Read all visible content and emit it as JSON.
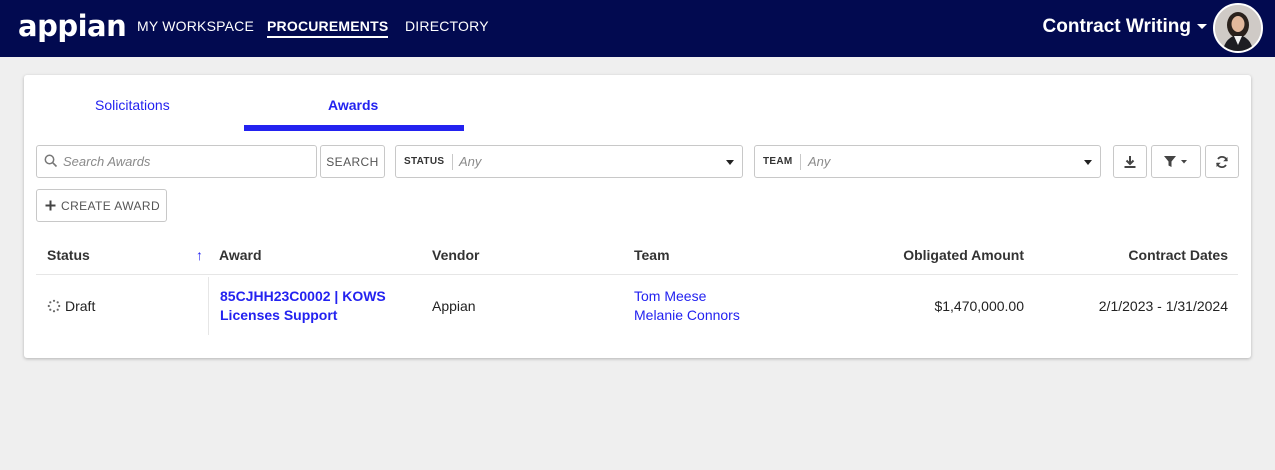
{
  "app": {
    "logo": "appian",
    "site_name": "Contract Writing"
  },
  "nav": [
    {
      "label": "MY WORKSPACE",
      "active": false
    },
    {
      "label": "PROCUREMENTS",
      "active": true
    },
    {
      "label": "DIRECTORY",
      "active": false
    }
  ],
  "tabs": [
    {
      "label": "Solicitations",
      "active": false
    },
    {
      "label": "Awards",
      "active": true
    }
  ],
  "toolbar": {
    "search_placeholder": "Search Awards",
    "search_button": "SEARCH",
    "status_label": "STATUS",
    "status_value": "Any",
    "team_label": "TEAM",
    "team_value": "Any",
    "create_button": "CREATE AWARD"
  },
  "table": {
    "headers": [
      "Status",
      "Award",
      "Vendor",
      "Team",
      "Obligated Amount",
      "Contract Dates"
    ],
    "sort_indicator": "↑",
    "rows": [
      {
        "status": "Draft",
        "award_line1": "85CJHH23C0002 | KOWS",
        "award_line2": "Licenses Support",
        "vendor": "Appian",
        "team": [
          "Tom Meese",
          "Melanie Connors"
        ],
        "obligated_amount": "$1,470,000.00",
        "contract_dates": "2/1/2023 - 1/31/2024"
      }
    ]
  },
  "colors": {
    "nav_bg": "#020a50",
    "accent": "#2322f0",
    "page_bg": "#efefef"
  }
}
